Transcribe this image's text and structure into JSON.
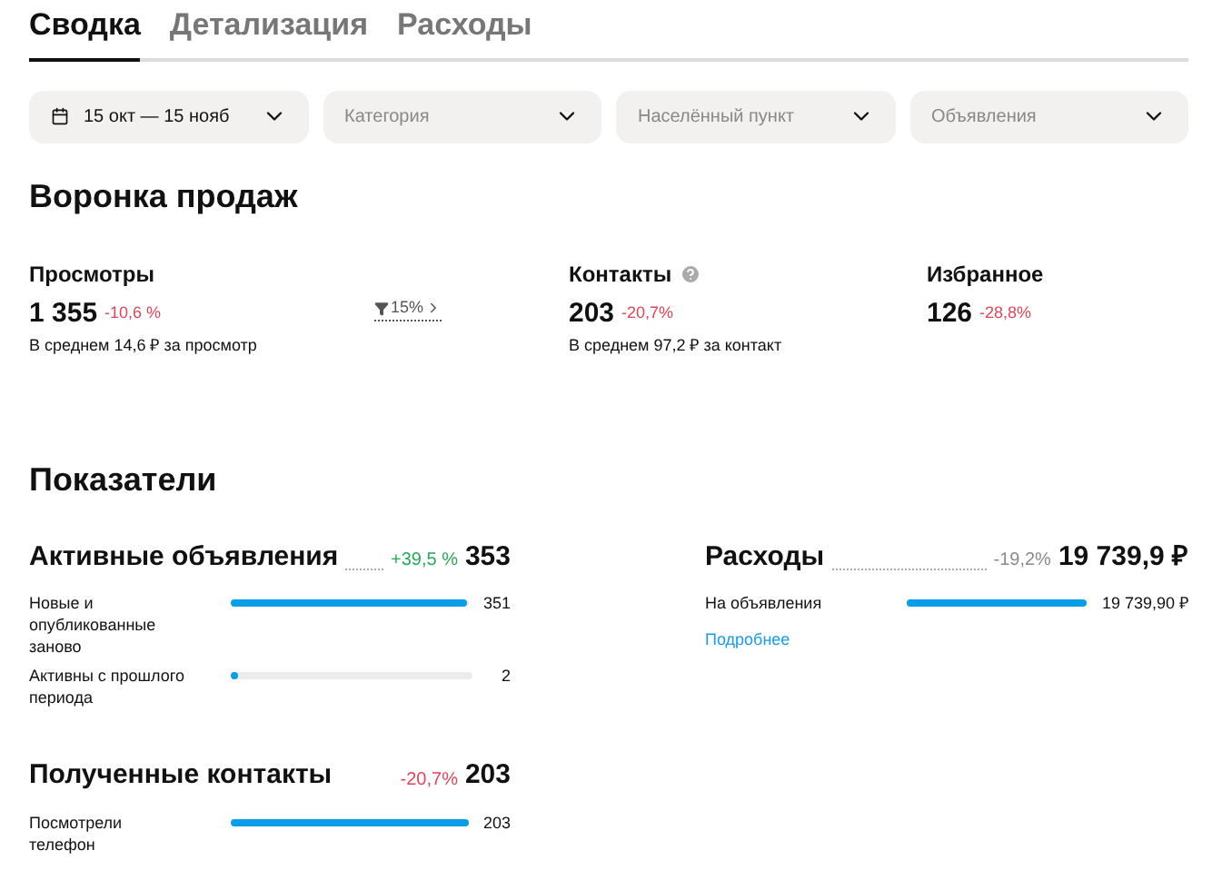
{
  "tabs": [
    {
      "label": "Сводка",
      "selected": true
    },
    {
      "label": "Детализация",
      "selected": false
    },
    {
      "label": "Расходы",
      "selected": false
    }
  ],
  "filters": [
    {
      "kind": "date",
      "value": "15 окт — 15 нояб"
    },
    {
      "kind": "select",
      "placeholder": "Категория"
    },
    {
      "kind": "select",
      "placeholder": "Населённый пункт"
    },
    {
      "kind": "select",
      "placeholder": "Объявления"
    }
  ],
  "funnel": {
    "title": "Воронка продаж",
    "metrics": [
      {
        "label": "Просмотры",
        "value": "1 355",
        "change": "-10,6 %",
        "color": "#e0465b",
        "note": "В среднем 14,6 ₽ за просмотр",
        "help": false,
        "step": "15%"
      },
      {
        "label": "Контакты",
        "value": "203",
        "change": "-20,7%",
        "color": "#e0465b",
        "note": "В среднем 97,2 ₽ за контакт",
        "help": true
      },
      {
        "label": "Избранное",
        "value": "126",
        "change": "-28,8%",
        "color": "#e0465b",
        "help": false
      }
    ]
  },
  "indicators": {
    "title": "Показатели",
    "blocks": [
      {
        "title": "Активные объявления",
        "change": "+39,5 %",
        "color": "#2aa85a",
        "total": "353",
        "dotted": true,
        "rows": [
          {
            "label": "Новые и опубликованные заново",
            "level": 0.99,
            "value": "351"
          },
          {
            "label": "Активны с прошлого периода",
            "level": 0.02,
            "value": "2"
          }
        ]
      },
      {
        "title": "Расходы",
        "change": "-19,2%",
        "color": "#8a8a8a",
        "total": "19 739,9 ₽",
        "dotted": true,
        "rows": [
          {
            "label": "На объявления",
            "level": 1,
            "value": "19 739,90 ₽"
          }
        ],
        "link": "Подробнее"
      },
      {
        "title": "Полученные контакты",
        "change": "-20,7%",
        "color": "#e0465b",
        "total": "203",
        "dotted": false,
        "rows": [
          {
            "label": "Посмотрели телефон",
            "level": 1,
            "value": "203"
          }
        ]
      }
    ]
  }
}
